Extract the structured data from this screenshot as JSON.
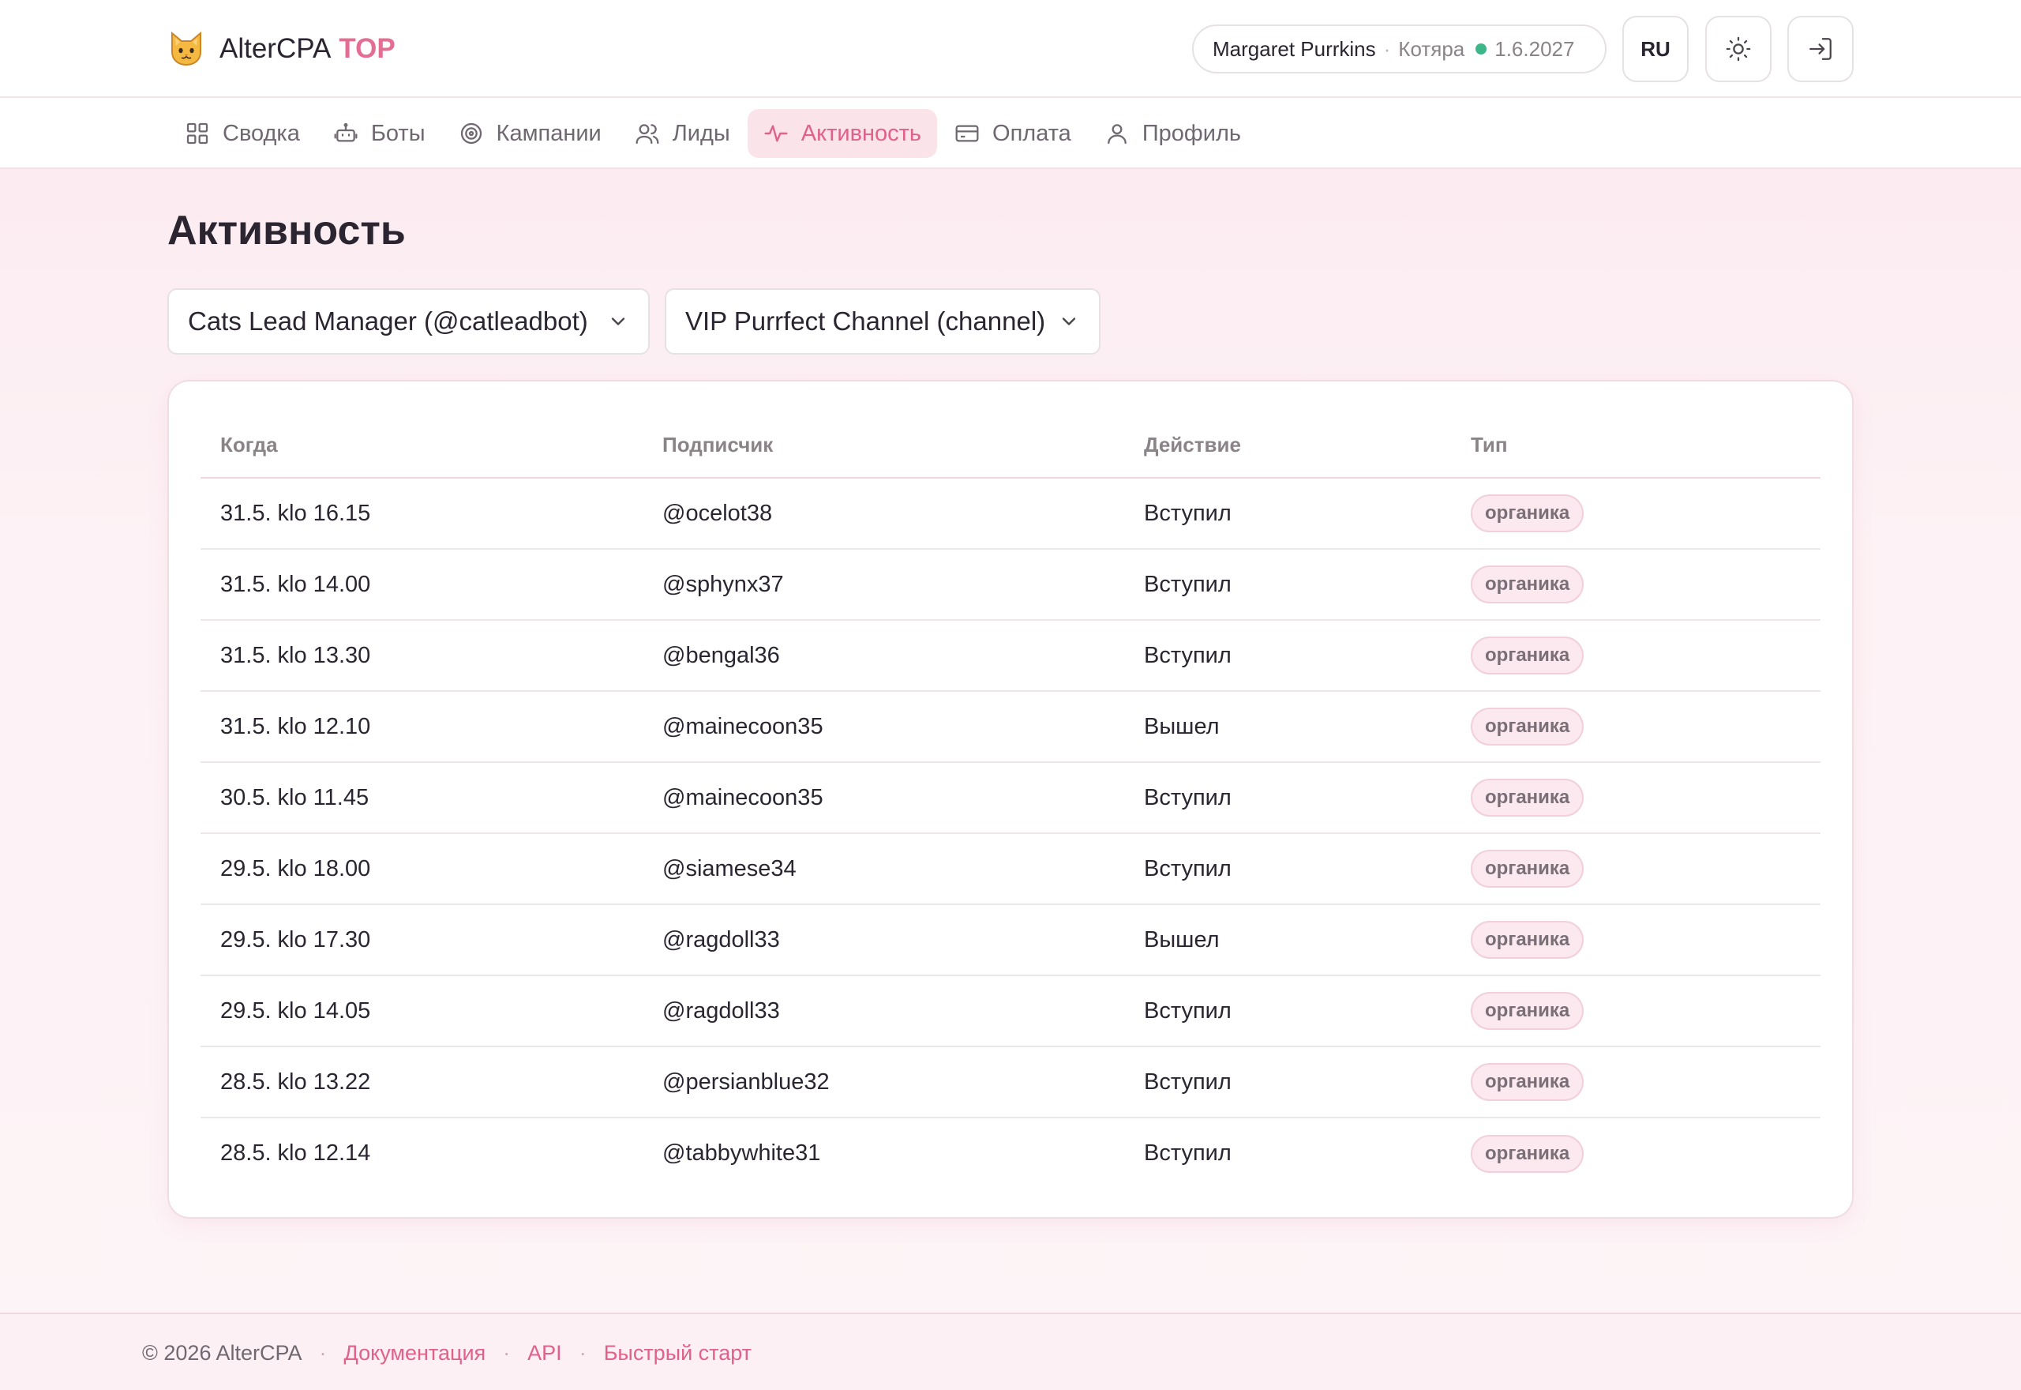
{
  "header": {
    "brand_name": "AlterCPA",
    "brand_suffix": "TOP",
    "user": {
      "name": "Margaret Purrkins",
      "separator": "·",
      "plan": "Котяра",
      "expiry": "1.6.2027",
      "status_color": "#3db68a"
    },
    "lang_label": "RU",
    "icons": {
      "theme": "sun-icon",
      "logout": "logout-icon",
      "logo": "cat-face-icon"
    }
  },
  "nav": {
    "items": [
      {
        "label": "Сводка",
        "icon": "grid-icon",
        "active": false
      },
      {
        "label": "Боты",
        "icon": "robot-icon",
        "active": false
      },
      {
        "label": "Кампании",
        "icon": "target-icon",
        "active": false
      },
      {
        "label": "Лиды",
        "icon": "users-icon",
        "active": false
      },
      {
        "label": "Активность",
        "icon": "activity-icon",
        "active": true
      },
      {
        "label": "Оплата",
        "icon": "credit-card-icon",
        "active": false
      },
      {
        "label": "Профиль",
        "icon": "user-icon",
        "active": false
      }
    ]
  },
  "page": {
    "title": "Активность",
    "bot_select": {
      "value": "Cats Lead Manager (@catleadbot)"
    },
    "channel_select": {
      "value": "VIP Purrfect Channel (channel)"
    }
  },
  "table": {
    "headers": {
      "when": "Когда",
      "subscriber": "Подписчик",
      "action": "Действие",
      "type": "Тип"
    },
    "rows": [
      {
        "when": "31.5. klo 16.15",
        "subscriber": "@ocelot38",
        "action": "Вступил",
        "type": "органика"
      },
      {
        "when": "31.5. klo 14.00",
        "subscriber": "@sphynx37",
        "action": "Вступил",
        "type": "органика"
      },
      {
        "when": "31.5. klo 13.30",
        "subscriber": "@bengal36",
        "action": "Вступил",
        "type": "органика"
      },
      {
        "when": "31.5. klo 12.10",
        "subscriber": "@mainecoon35",
        "action": "Вышел",
        "type": "органика"
      },
      {
        "when": "30.5. klo 11.45",
        "subscriber": "@mainecoon35",
        "action": "Вступил",
        "type": "органика"
      },
      {
        "when": "29.5. klo 18.00",
        "subscriber": "@siamese34",
        "action": "Вступил",
        "type": "органика"
      },
      {
        "when": "29.5. klo 17.30",
        "subscriber": "@ragdoll33",
        "action": "Вышел",
        "type": "органика"
      },
      {
        "when": "29.5. klo 14.05",
        "subscriber": "@ragdoll33",
        "action": "Вступил",
        "type": "органика"
      },
      {
        "when": "28.5. klo 13.22",
        "subscriber": "@persianblue32",
        "action": "Вступил",
        "type": "органика"
      },
      {
        "when": "28.5. klo 12.14",
        "subscriber": "@tabbywhite31",
        "action": "Вступил",
        "type": "органика"
      }
    ]
  },
  "footer": {
    "copyright": "© 2026 AlterCPA",
    "separator": "·",
    "links": {
      "docs": "Документация",
      "api": "API",
      "quickstart": "Быстрый старт"
    }
  },
  "colors": {
    "accent": "#e0618a",
    "accent_bg": "#fbe3ea",
    "brand_suffix": "#e46d93"
  }
}
